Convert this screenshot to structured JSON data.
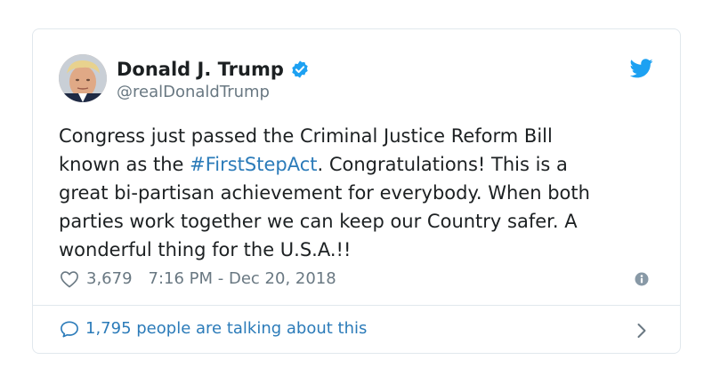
{
  "tweet": {
    "author": {
      "display_name": "Donald J. Trump",
      "handle": "@realDonaldTrump",
      "verified": true
    },
    "text": {
      "line1": "Congress just passed the Criminal Justice Reform Bill",
      "line2_before": "known as the ",
      "hashtag": "#FirstStepAct",
      "line2_after": ". Congratulations! This is a",
      "line3": "great bi-partisan achievement for everybody. When both",
      "line4": "parties work together we can keep our Country safer. A",
      "line5": "wonderful thing for the U.S.A.!!"
    },
    "like_count": "3,679",
    "timestamp": "7:16 PM - Dec 20, 2018",
    "conversation_label": "1,795 people are talking about this"
  },
  "colors": {
    "twitter_blue": "#1da1f2",
    "link_blue": "#2b7bb9",
    "meta_gray": "#697882",
    "border": "#e1e8ed"
  },
  "icons": [
    "verified-icon",
    "twitter-icon",
    "heart-icon",
    "info-icon",
    "comment-icon",
    "chevron-right-icon"
  ]
}
